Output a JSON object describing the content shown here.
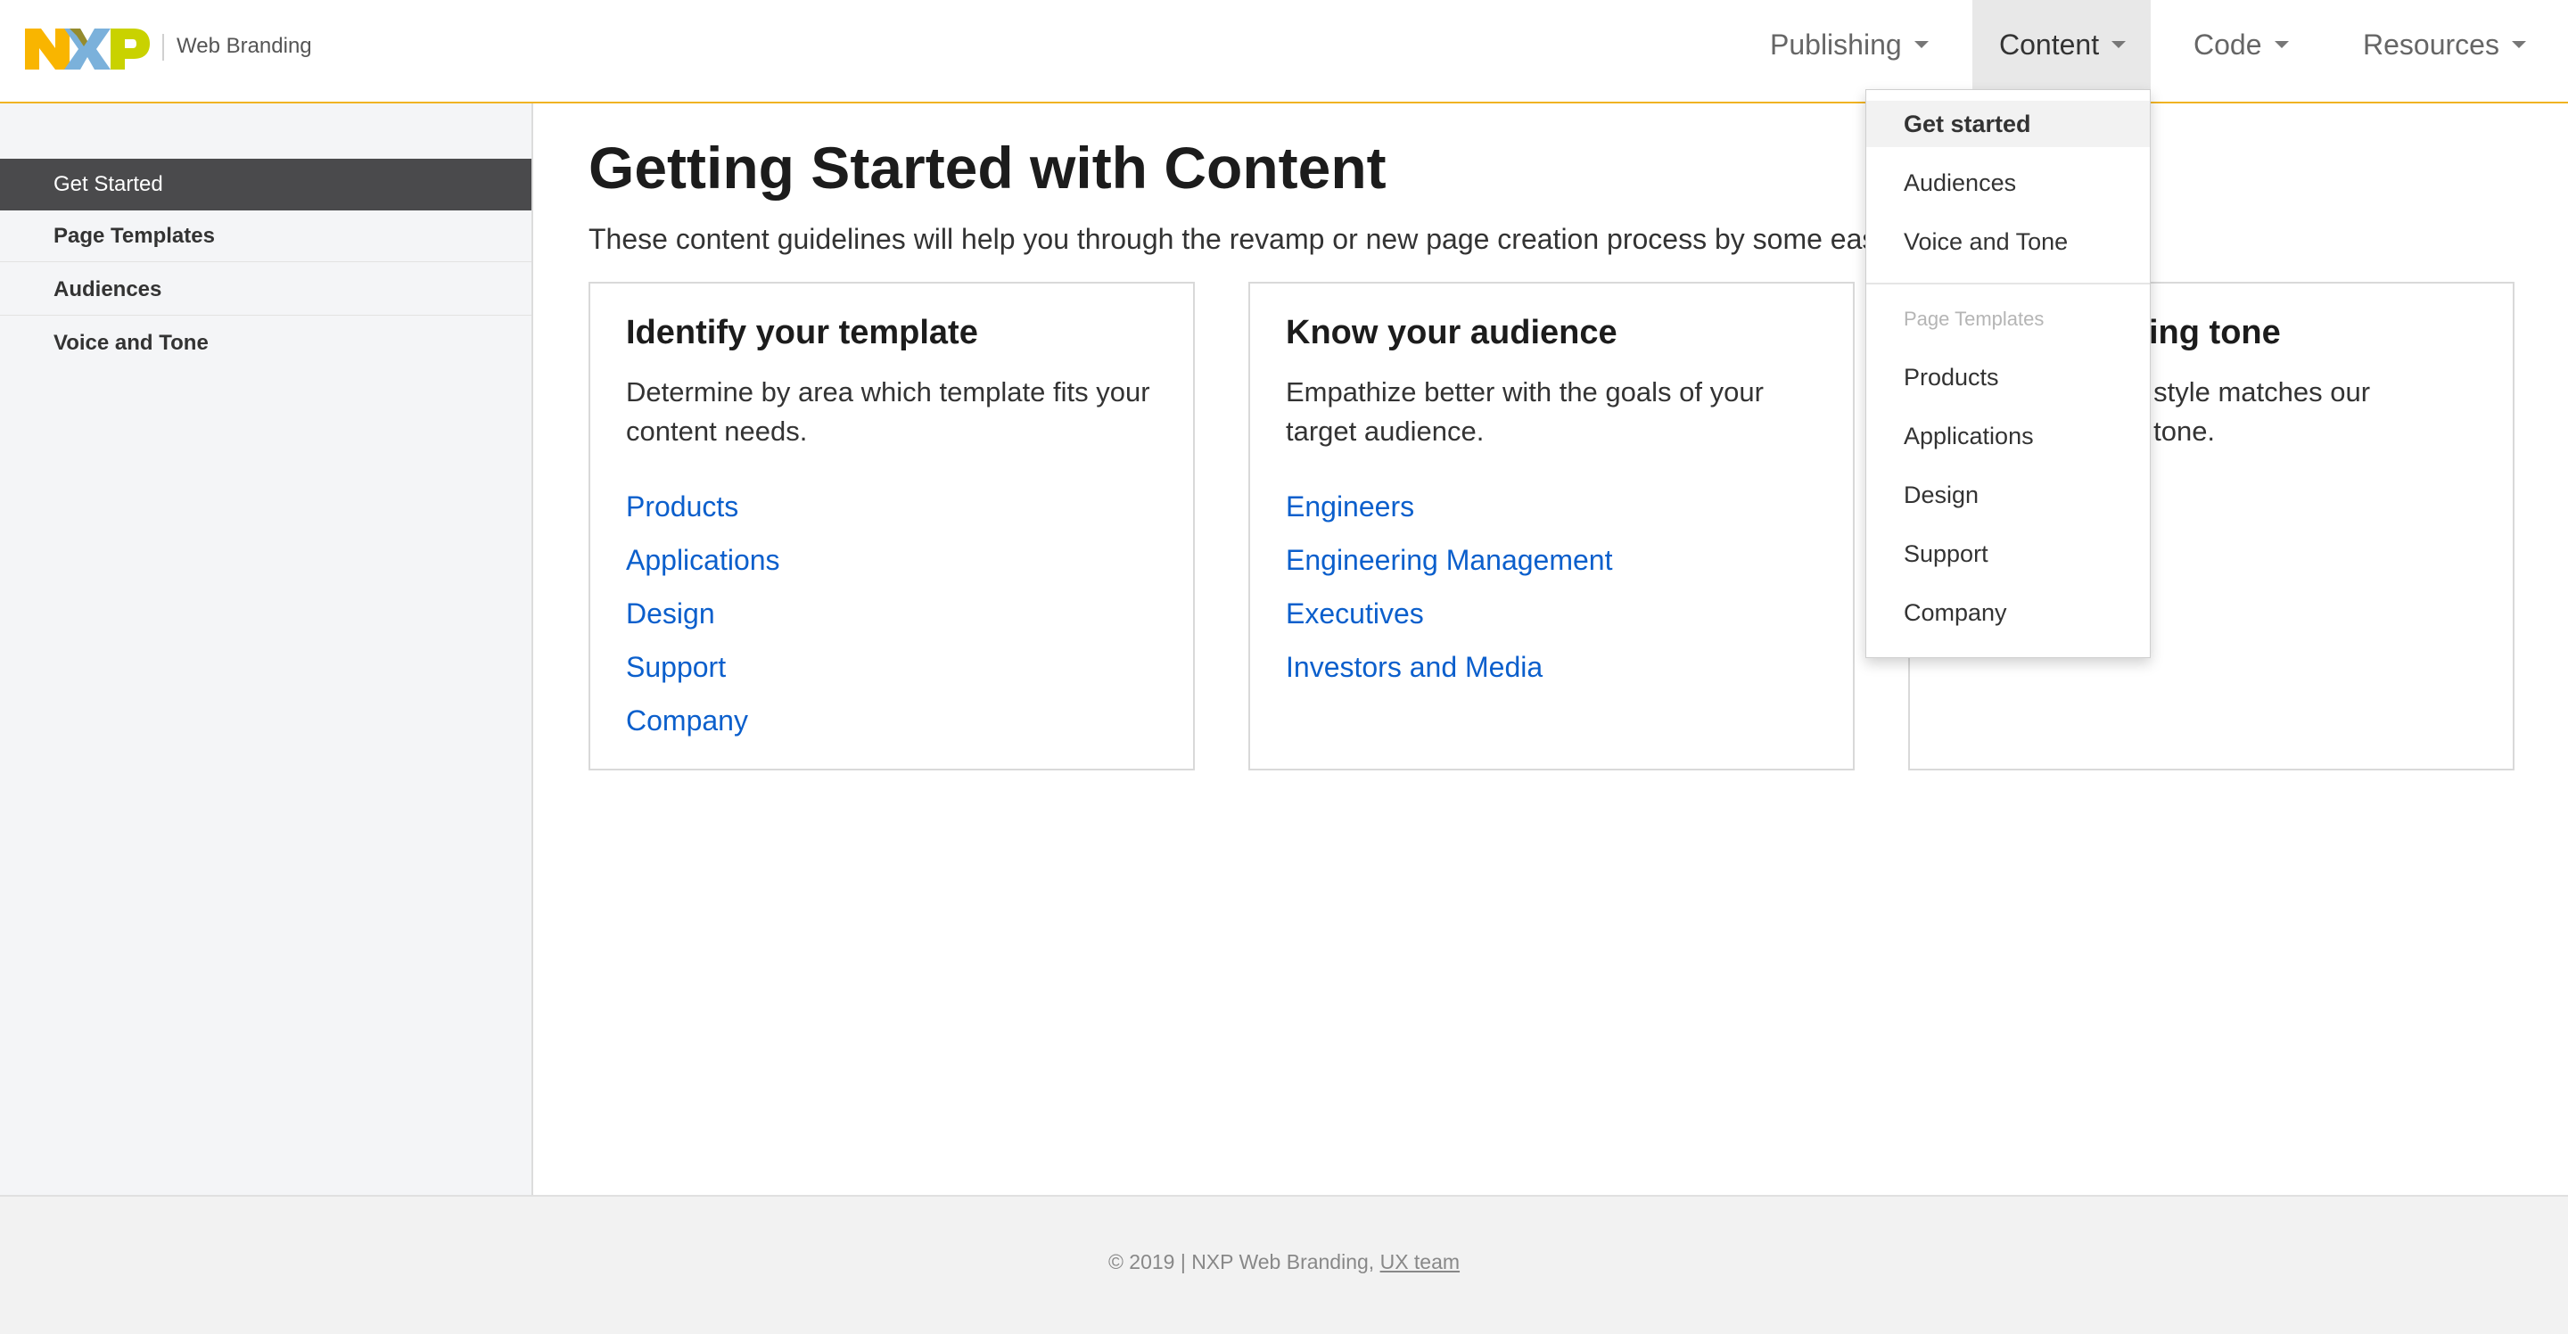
{
  "header": {
    "logo_text": "NXP",
    "site_name": "Web Branding",
    "nav": [
      {
        "label": "Publishing"
      },
      {
        "label": "Content"
      },
      {
        "label": "Code"
      },
      {
        "label": "Resources"
      }
    ],
    "active_nav": "Content",
    "accent_color": "#f0b323"
  },
  "sidebar": {
    "items": [
      {
        "label": "Get Started",
        "active": true
      },
      {
        "label": "Page Templates"
      },
      {
        "label": "Audiences"
      },
      {
        "label": "Voice and Tone"
      }
    ]
  },
  "main": {
    "title": "Getting Started with Content",
    "intro": "These content guidelines will help you through the revamp or new page creation process by some eas",
    "cards": [
      {
        "title": "Identify your template",
        "description": "Determine by area which template fits your content needs.",
        "links": [
          "Products",
          "Applications",
          "Design",
          "Support",
          "Company"
        ]
      },
      {
        "title": "Know your audience",
        "description": "Empathize better with the goals of your target audience.",
        "links": [
          "Engineers",
          "Engineering Management",
          "Executives",
          "Investors and Media"
        ]
      },
      {
        "title": "riting tone",
        "description_line1": "ng style matches our",
        "description_line2": "nd tone."
      }
    ]
  },
  "dropdown": {
    "items": [
      "Get started",
      "Audiences",
      "Voice and Tone"
    ],
    "section_header": "Page Templates",
    "template_items": [
      "Products",
      "Applications",
      "Design",
      "Support",
      "Company"
    ]
  },
  "footer": {
    "text": "© 2019 | NXP Web Branding, ",
    "link": "UX team"
  }
}
